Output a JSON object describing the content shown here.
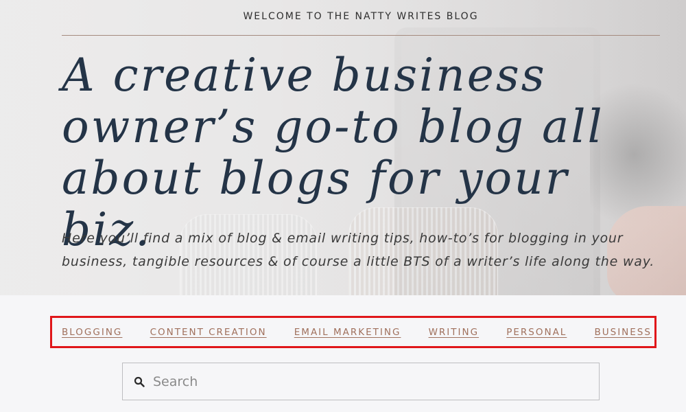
{
  "hero": {
    "welcome": "WELCOME TO THE NATTY WRITES BLOG",
    "headline": "A creative business owner’s go-to blog all about blogs for your biz.",
    "intro": "Here you’ll find a mix of blog & email writing tips, how-to’s for blogging in your business, tangible resources & of course a little BTS of a writer’s life along the way."
  },
  "categories": [
    {
      "label": "BLOGGING"
    },
    {
      "label": "CONTENT CREATION"
    },
    {
      "label": "EMAIL MARKETING"
    },
    {
      "label": "WRITING"
    },
    {
      "label": "PERSONAL"
    },
    {
      "label": "BUSINESS"
    }
  ],
  "search": {
    "placeholder": "Search",
    "icon": "search-icon"
  },
  "colors": {
    "headline": "#243447",
    "category_link": "#a0705c",
    "highlight_box": "#e0161a",
    "rule": "#a48a7e"
  }
}
